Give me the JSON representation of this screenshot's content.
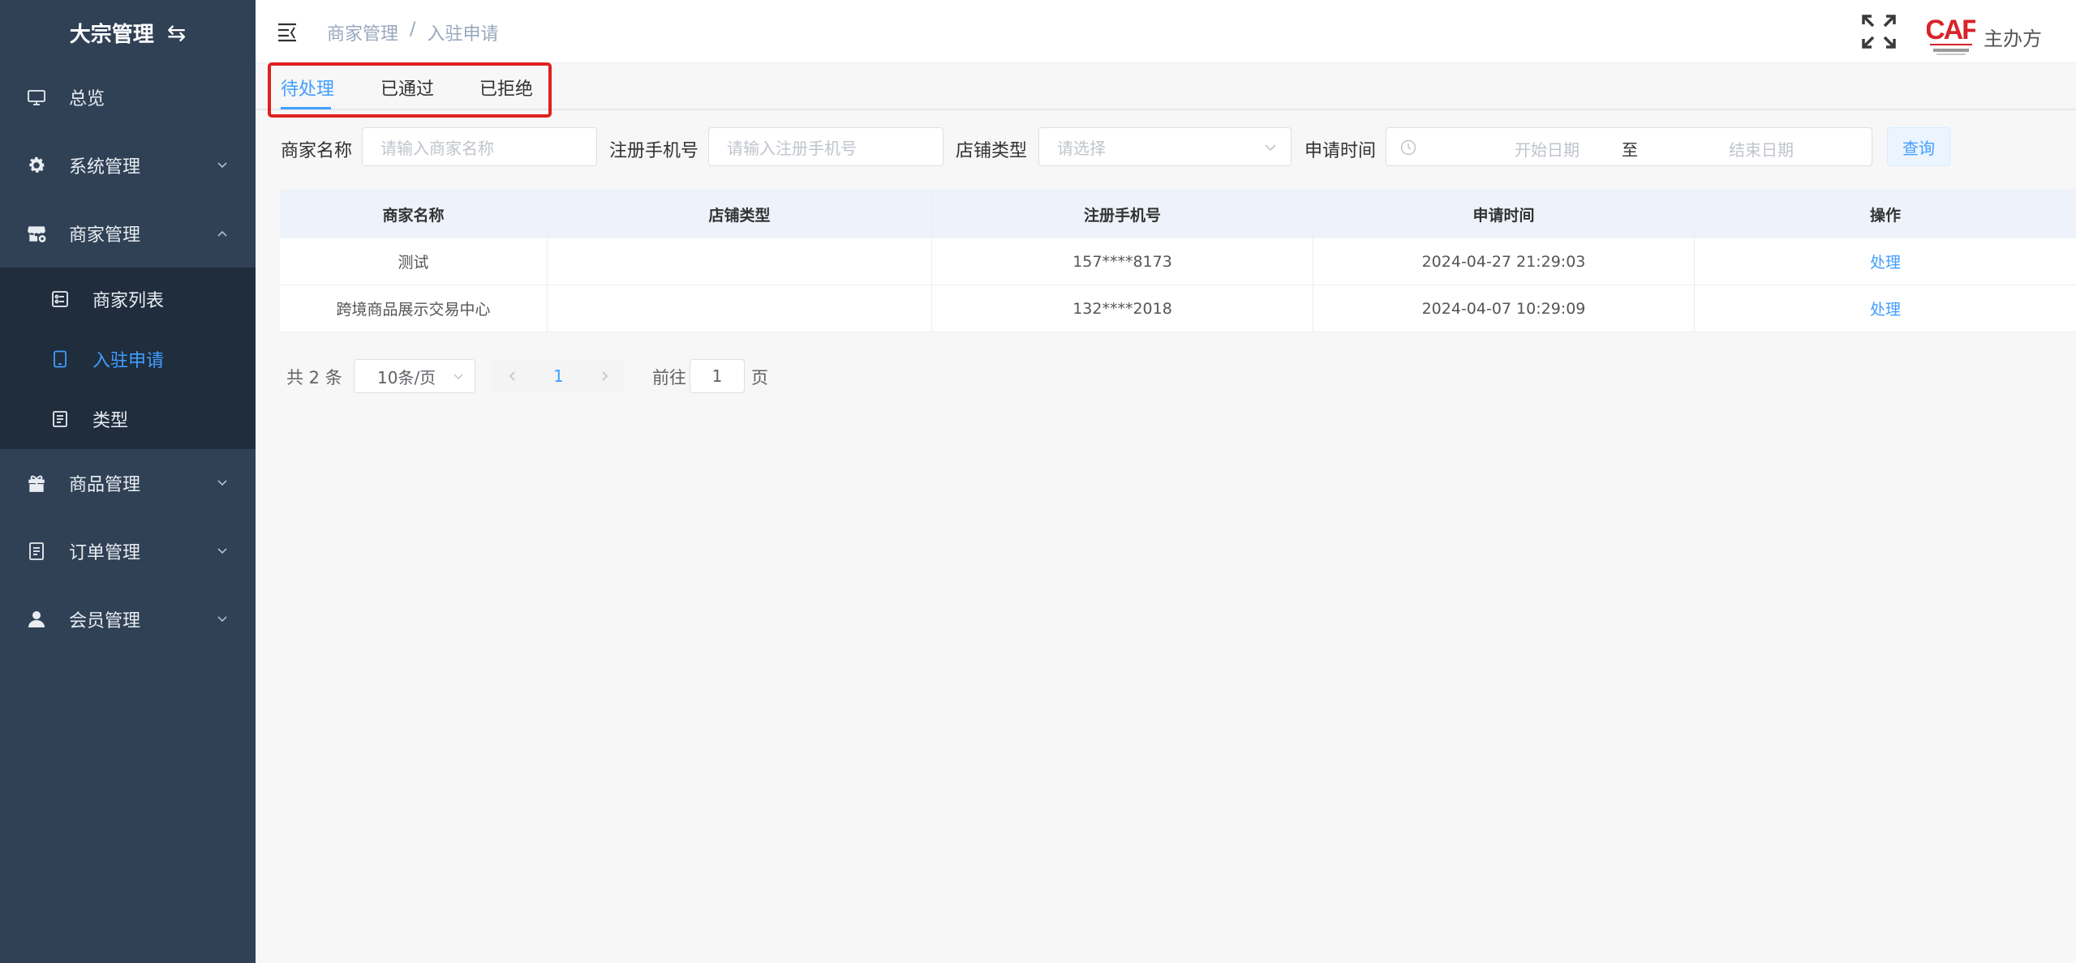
{
  "sidebar": {
    "title": "大宗管理",
    "items": [
      {
        "label": "总览",
        "icon": "monitor-icon"
      },
      {
        "label": "系统管理",
        "icon": "gear-icon"
      },
      {
        "label": "商家管理",
        "icon": "store-icon"
      },
      {
        "label": "商品管理",
        "icon": "gift-icon"
      },
      {
        "label": "订单管理",
        "icon": "document-icon"
      },
      {
        "label": "会员管理",
        "icon": "user-icon"
      }
    ],
    "subitems": [
      {
        "label": "商家列表",
        "icon": "list-icon"
      },
      {
        "label": "入驻申请",
        "icon": "tablet-icon",
        "active": true
      },
      {
        "label": "类型",
        "icon": "document-icon"
      }
    ]
  },
  "header": {
    "breadcrumb": [
      "商家管理",
      "/",
      "入驻申请"
    ],
    "logo_text": "CAF",
    "organizer": "主办方"
  },
  "tabs": [
    {
      "label": "待处理",
      "active": true
    },
    {
      "label": "已通过"
    },
    {
      "label": "已拒绝"
    }
  ],
  "filters": {
    "merchant_name_label": "商家名称",
    "merchant_name_placeholder": "请输入商家名称",
    "phone_label": "注册手机号",
    "phone_placeholder": "请输入注册手机号",
    "store_type_label": "店铺类型",
    "store_type_placeholder": "请选择",
    "apply_time_label": "申请时间",
    "start_date_placeholder": "开始日期",
    "range_separator": "至",
    "end_date_placeholder": "结束日期",
    "query_button": "查询"
  },
  "table": {
    "columns": [
      "商家名称",
      "店铺类型",
      "注册手机号",
      "申请时间",
      "操作"
    ],
    "rows": [
      {
        "name": "测试",
        "type": "",
        "phone": "157****8173",
        "time": "2024-04-27 21:29:03",
        "action": "处理"
      },
      {
        "name": "跨境商品展示交易中心",
        "type": "",
        "phone": "132****2018",
        "time": "2024-04-07 10:29:09",
        "action": "处理"
      }
    ]
  },
  "pagination": {
    "total": "共 2 条",
    "page_size": "10条/页",
    "current_page": "1",
    "goto_label": "前往",
    "goto_value": "1",
    "page_unit": "页"
  },
  "colors": {
    "sidebar_bg": "#304156",
    "submenu_bg": "#1f2d3d",
    "accent": "#409eff",
    "highlight_border": "#e02020",
    "logo_red": "#d8232a"
  }
}
